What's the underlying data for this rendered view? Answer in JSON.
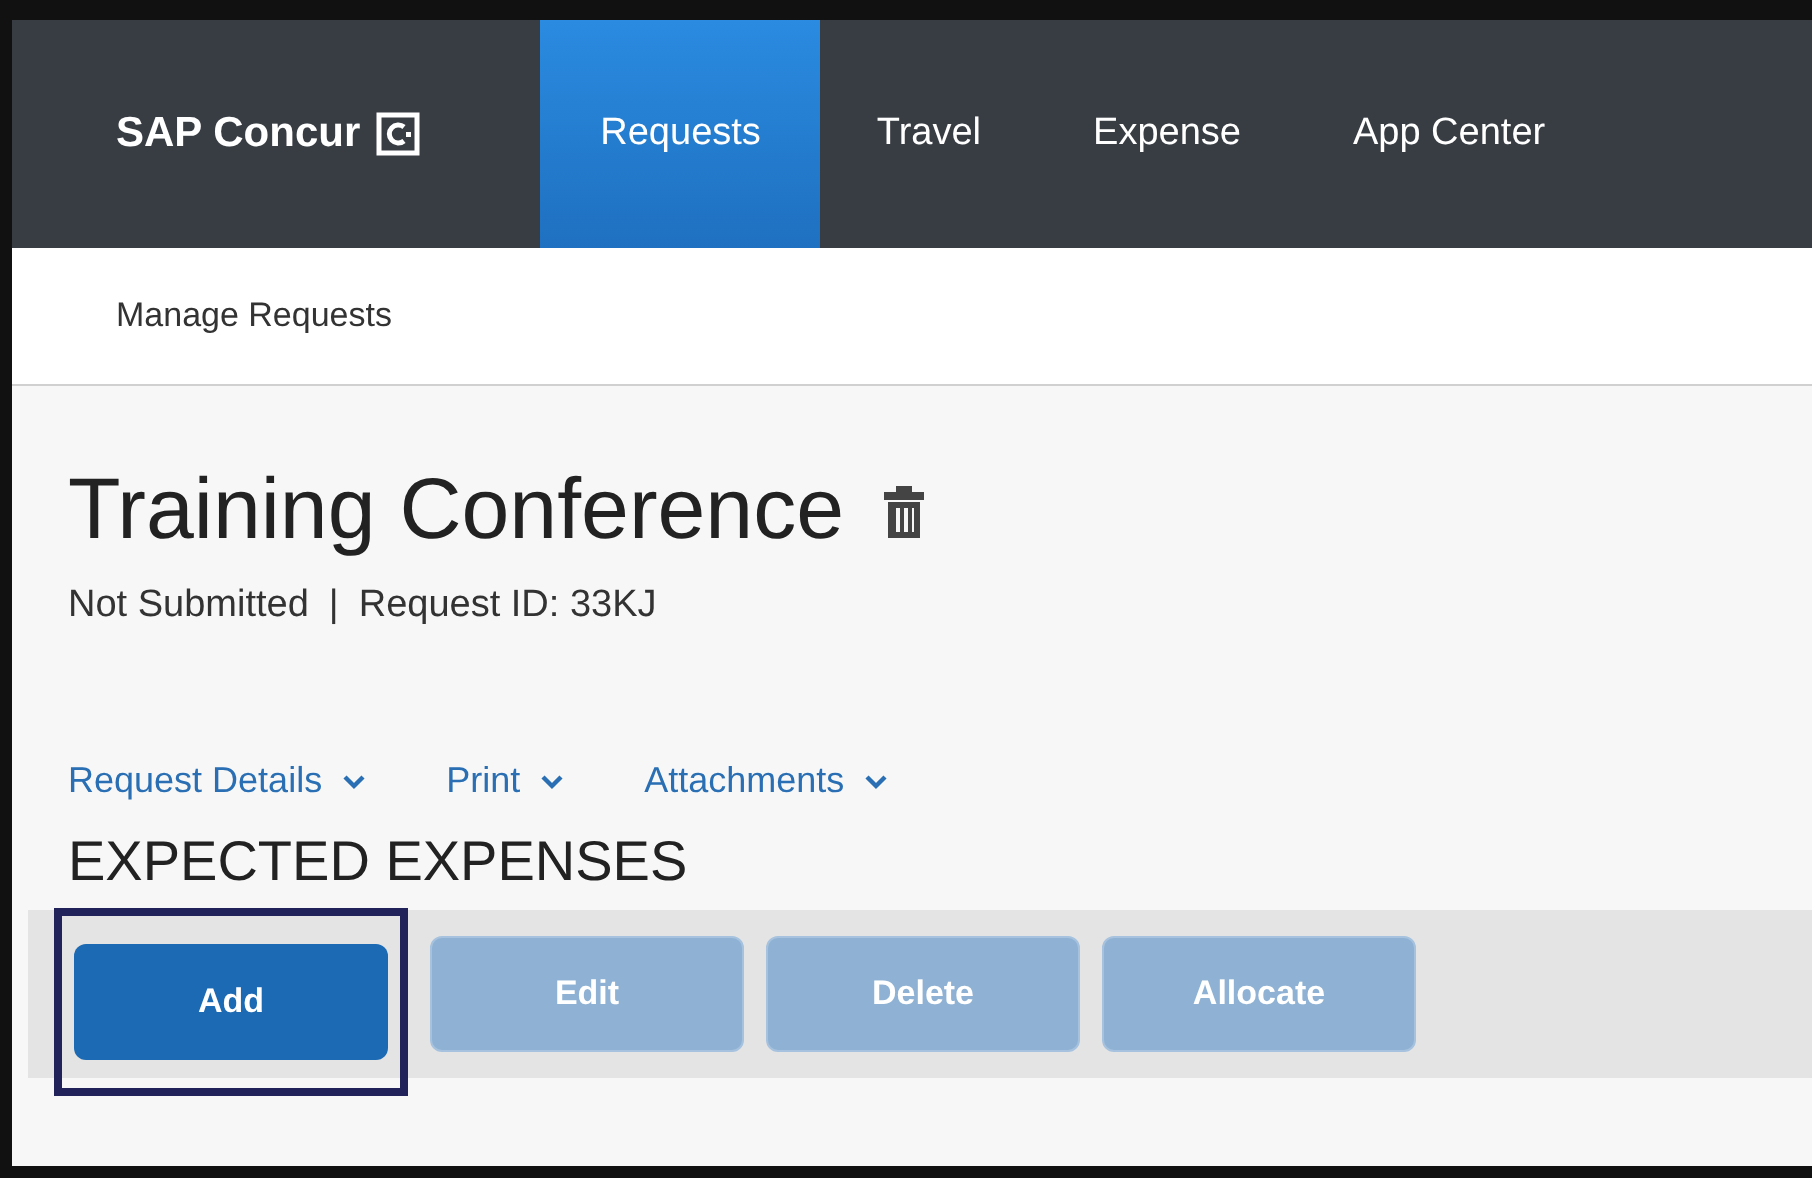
{
  "nav": {
    "logo": "SAP Concur",
    "tabs": [
      {
        "label": "Requests",
        "selected": true
      },
      {
        "label": "Travel",
        "selected": false
      },
      {
        "label": "Expense",
        "selected": false
      },
      {
        "label": "App Center",
        "selected": false
      }
    ]
  },
  "subnav": {
    "label": "Manage Requests"
  },
  "request": {
    "title": "Training Conference",
    "status": "Not Submitted",
    "separator": "|",
    "id": "Request ID: 33KJ"
  },
  "menus": [
    "Request Details",
    "Print",
    "Attachments"
  ],
  "section": {
    "heading": "EXPECTED EXPENSES",
    "buttons": [
      {
        "label": "Add",
        "disabled": false,
        "highlighted": true
      },
      {
        "label": "Edit",
        "disabled": true,
        "highlighted": false
      },
      {
        "label": "Delete",
        "disabled": true,
        "highlighted": false
      },
      {
        "label": "Allocate",
        "disabled": true,
        "highlighted": false
      }
    ]
  }
}
